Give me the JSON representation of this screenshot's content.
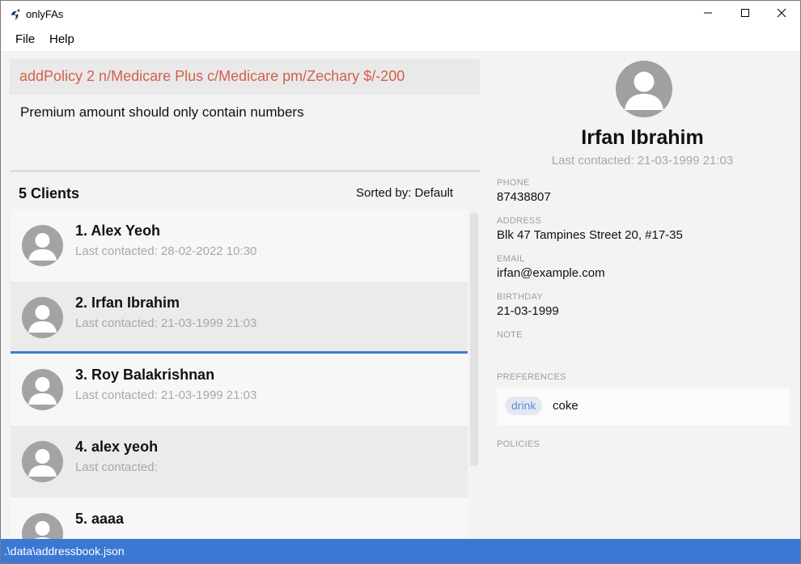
{
  "window": {
    "title": "onlyFAs"
  },
  "menu": {
    "file": "File",
    "help": "Help"
  },
  "command": {
    "text": "addPolicy 2 n/Medicare Plus c/Medicare pm/Zechary $/-200"
  },
  "result": {
    "text": "Premium amount should only contain numbers"
  },
  "list": {
    "header": "5 Clients",
    "sort_label": "Sorted by: Default",
    "clients": [
      {
        "name": "1.  Alex Yeoh",
        "last_contacted": "Last contacted: 28-02-2022 10:30"
      },
      {
        "name": "2.  Irfan Ibrahim",
        "last_contacted": "Last contacted: 21-03-1999 21:03"
      },
      {
        "name": "3.  Roy Balakrishnan",
        "last_contacted": "Last contacted: 21-03-1999 21:03"
      },
      {
        "name": "4.  alex yeoh",
        "last_contacted": "Last contacted:"
      },
      {
        "name": "5.  aaaa",
        "last_contacted": ""
      }
    ]
  },
  "detail": {
    "name": "Irfan Ibrahim",
    "last_contacted": "Last contacted: 21-03-1999 21:03",
    "phone_label": "PHONE",
    "phone": "87438807",
    "address_label": "ADDRESS",
    "address": "Blk 47 Tampines Street 20, #17-35",
    "email_label": "EMAIL",
    "email": "irfan@example.com",
    "birthday_label": "BIRTHDAY",
    "birthday": "21-03-1999",
    "note_label": "NOTE",
    "preferences_label": "PREFERENCES",
    "preference_tag": "drink",
    "preference_value": "coke",
    "policies_label": "POLICIES"
  },
  "status": {
    "path": ".\\data\\addressbook.json"
  },
  "colors": {
    "accent": "#3b78d4",
    "error_text": "#d3604a",
    "muted_text": "#a8a8a8"
  }
}
